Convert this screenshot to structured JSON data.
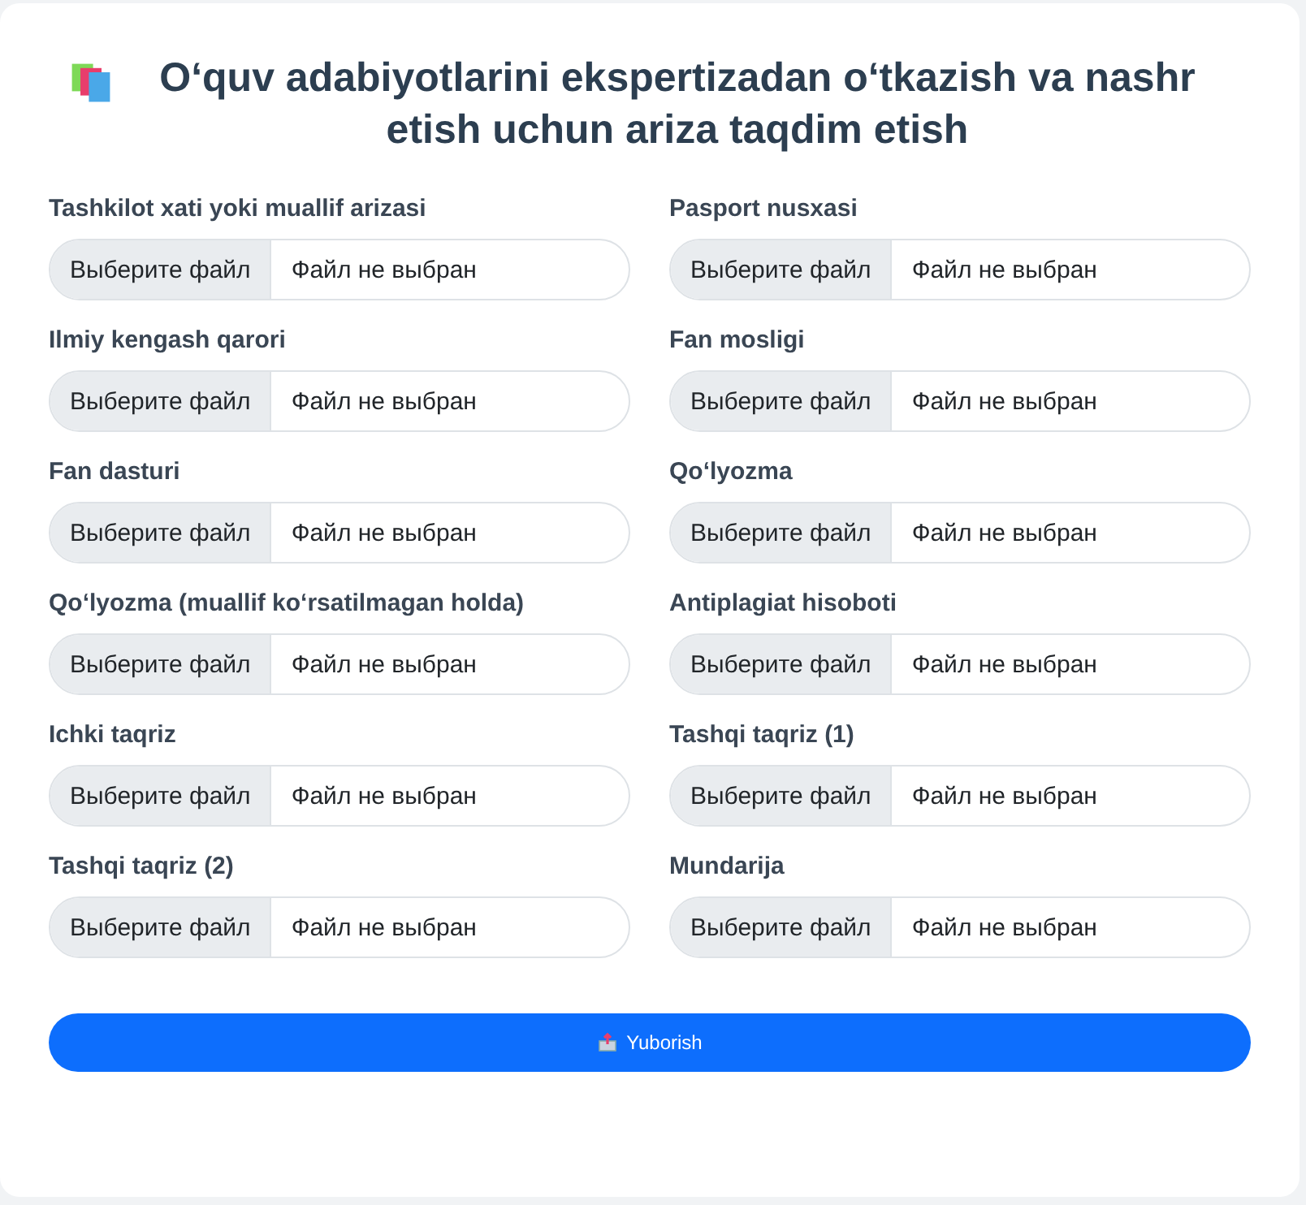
{
  "title": "Oʻquv adabiyotlarini ekspertizadan oʻtkazish va nashr etish uchun ariza taqdim etish",
  "fields": [
    {
      "label": "Tashkilot xati yoki muallif arizasi",
      "button": "Выберите файл",
      "status": "Файл не выбран"
    },
    {
      "label": "Pasport nusxasi",
      "button": "Выберите файл",
      "status": "Файл не выбран"
    },
    {
      "label": "Ilmiy kengash qarori",
      "button": "Выберите файл",
      "status": "Файл не выбран"
    },
    {
      "label": "Fan mosligi",
      "button": "Выберите файл",
      "status": "Файл не выбран"
    },
    {
      "label": "Fan dasturi",
      "button": "Выберите файл",
      "status": "Файл не выбран"
    },
    {
      "label": "Qoʻlyozma",
      "button": "Выберите файл",
      "status": "Файл не выбран"
    },
    {
      "label": "Qoʻlyozma (muallif koʻrsatilmagan holda)",
      "button": "Выберите файл",
      "status": "Файл не выбран"
    },
    {
      "label": "Antiplagiat hisoboti",
      "button": "Выберите файл",
      "status": "Файл не выбран"
    },
    {
      "label": "Ichki taqriz",
      "button": "Выберите файл",
      "status": "Файл не выбран"
    },
    {
      "label": "Tashqi taqriz (1)",
      "button": "Выберите файл",
      "status": "Файл не выбран"
    },
    {
      "label": "Tashqi taqriz (2)",
      "button": "Выберите файл",
      "status": "Файл не выбран"
    },
    {
      "label": "Mundarija",
      "button": "Выберите файл",
      "status": "Файл не выбран"
    }
  ],
  "submit": "Yuborish"
}
